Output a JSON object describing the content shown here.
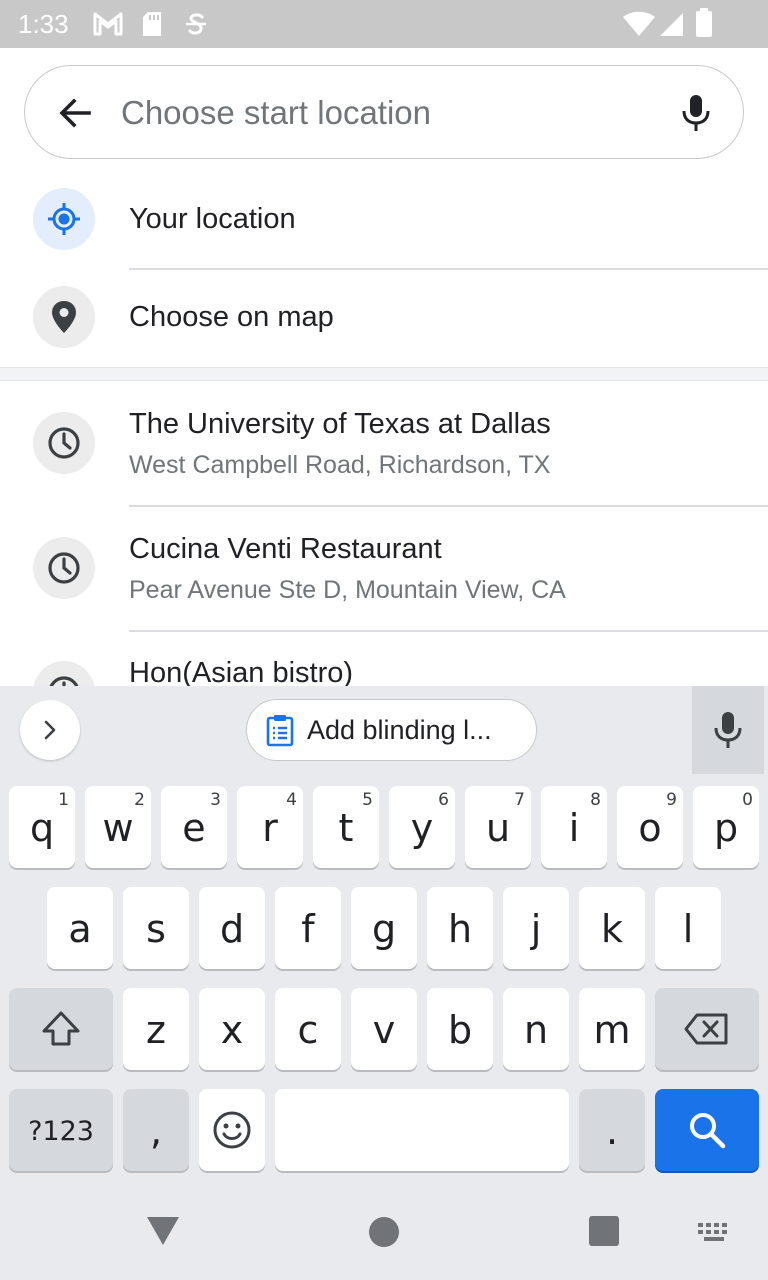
{
  "status_bar": {
    "time": "1:33",
    "left_icons": [
      "gmail-icon",
      "sd-card-icon",
      "vpn-s-icon"
    ],
    "right_icons": [
      "wifi-icon",
      "cell-signal-icon",
      "battery-icon"
    ]
  },
  "search": {
    "placeholder": "Choose start location",
    "value": "",
    "back_icon": "arrow-back-icon",
    "mic_icon": "mic-icon"
  },
  "quick_options": [
    {
      "label": "Your location",
      "icon": "my-location-icon",
      "icon_color": "#1a73e8"
    },
    {
      "label": "Choose on map",
      "icon": "map-pin-icon",
      "icon_color": "#3c4043"
    }
  ],
  "history": [
    {
      "title": "The University of Texas at Dallas",
      "subtitle": "West Campbell Road, Richardson, TX",
      "icon": "history-clock-icon"
    },
    {
      "title": "Cucina Venti Restaurant",
      "subtitle": "Pear Avenue Ste D, Mountain View, CA",
      "icon": "history-clock-icon"
    },
    {
      "title": "Hon(Asian bistro)",
      "subtitle": "",
      "icon": "history-clock-icon"
    }
  ],
  "keyboard": {
    "suggestion_chip": "Add blinding l...",
    "row1": [
      {
        "key": "q",
        "hint": "1"
      },
      {
        "key": "w",
        "hint": "2"
      },
      {
        "key": "e",
        "hint": "3"
      },
      {
        "key": "r",
        "hint": "4"
      },
      {
        "key": "t",
        "hint": "5"
      },
      {
        "key": "y",
        "hint": "6"
      },
      {
        "key": "u",
        "hint": "7"
      },
      {
        "key": "i",
        "hint": "8"
      },
      {
        "key": "o",
        "hint": "9"
      },
      {
        "key": "p",
        "hint": "0"
      }
    ],
    "row2": [
      "a",
      "s",
      "d",
      "f",
      "g",
      "h",
      "j",
      "k",
      "l"
    ],
    "row3": [
      "z",
      "x",
      "c",
      "v",
      "b",
      "n",
      "m"
    ],
    "symbols_label": "?123",
    "comma_label": ",",
    "period_label": ".",
    "accent_color": "#1a73e8"
  },
  "nav_bar": {
    "icons": [
      "back-triangle-icon",
      "home-circle-icon",
      "recents-square-icon",
      "keyboard-switch-icon"
    ]
  }
}
